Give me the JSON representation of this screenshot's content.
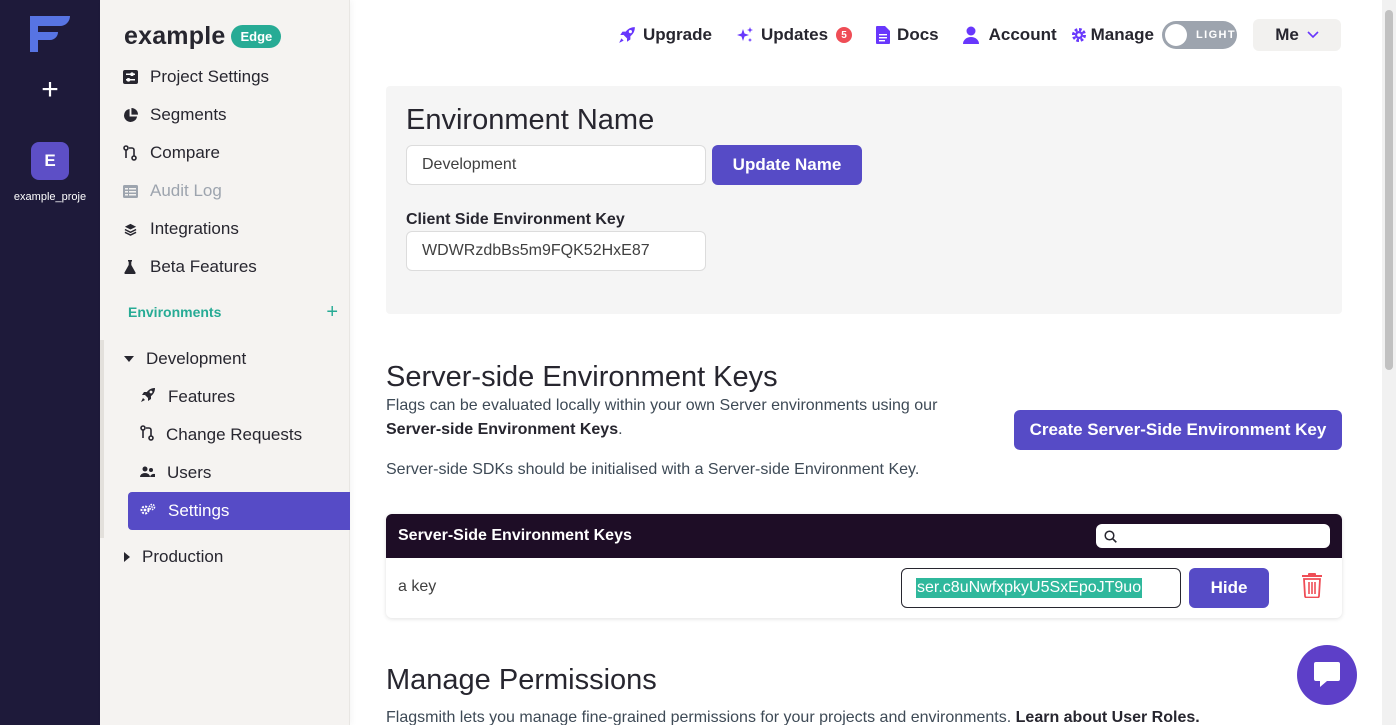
{
  "rail": {
    "project_initial": "E",
    "project_name": "example_proje"
  },
  "sidebar": {
    "project_name": "example",
    "edge_badge": "Edge",
    "items": [
      {
        "label": "Project Settings",
        "icon": "sliders-icon"
      },
      {
        "label": "Segments",
        "icon": "pie-chart-icon"
      },
      {
        "label": "Compare",
        "icon": "git-compare-icon"
      },
      {
        "label": "Audit Log",
        "icon": "list-icon"
      },
      {
        "label": "Integrations",
        "icon": "layers-icon"
      },
      {
        "label": "Beta Features",
        "icon": "flask-icon"
      }
    ],
    "environments_label": "Environments",
    "environments": [
      {
        "name": "Development",
        "expanded": true,
        "items": [
          {
            "label": "Features",
            "icon": "rocket-icon"
          },
          {
            "label": "Change Requests",
            "icon": "git-pull-icon"
          },
          {
            "label": "Users",
            "icon": "users-icon"
          },
          {
            "label": "Settings",
            "icon": "cog-icon",
            "active": true
          }
        ]
      },
      {
        "name": "Production",
        "expanded": false
      }
    ]
  },
  "topbar": {
    "upgrade": "Upgrade",
    "updates": "Updates",
    "updates_count": "5",
    "docs": "Docs",
    "account": "Account",
    "manage": "Manage",
    "theme_toggle": "LIGHT",
    "user_menu": "Me"
  },
  "env_name": {
    "title": "Environment Name",
    "value": "Development",
    "update_button": "Update Name",
    "client_key_label": "Client Side Environment Key",
    "client_key_value": "WDWRzdbBs5m9FQK52HxE87"
  },
  "server_keys": {
    "title": "Server-side Environment Keys",
    "desc_1": "Flags can be evaluated locally within your own Server environments using our",
    "desc_1_bold": "Server-side Environment Keys",
    "desc_2": "Server-side SDKs should be initialised with a Server-side Environment Key.",
    "create_button": "Create Server-Side Environment Key",
    "table_title": "Server-Side Environment Keys",
    "search_placeholder": "",
    "rows": [
      {
        "name": "a key",
        "key": "ser.c8uNwfxpkyU5SxEpoJT9uo",
        "action": "Hide"
      }
    ]
  },
  "permissions": {
    "title": "Manage Permissions",
    "desc": "Flagsmith lets you manage fine-grained permissions for your projects and environments.",
    "link": "Learn about User Roles."
  },
  "colors": {
    "primary": "#564bc6",
    "teal": "#27ab95",
    "rail": "#1e1a3a",
    "table_header": "#1e0d26",
    "danger": "#ef4d56"
  }
}
